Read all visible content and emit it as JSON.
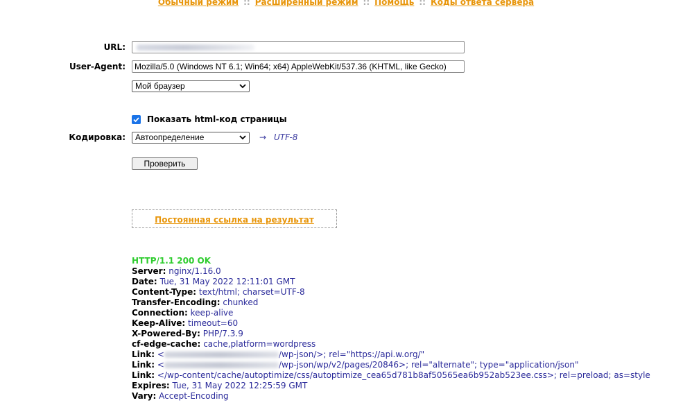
{
  "nav": {
    "items": [
      "Обычный режим",
      "Расширенный режим",
      "Помощь",
      "Коды ответа сервера"
    ],
    "separator": "::"
  },
  "form": {
    "url_label": "URL:",
    "url_value": "",
    "ua_label": "User-Agent:",
    "ua_value": "Mozilla/5.0 (Windows NT 6.1; Win64; x64) AppleWebKit/537.36 (KHTML, like Gecko)",
    "browser_select": "Мой браузер",
    "show_html_label": "Показать html-код страницы",
    "show_html_checked": true,
    "encoding_label": "Кодировка:",
    "encoding_select": "Автоопределение",
    "encoding_arrow": "→",
    "encoding_detected": "UTF-8",
    "submit_label": "Проверить"
  },
  "permalink": "Постоянная ссылка на результат",
  "response": {
    "status": "HTTP/1.1 200 OK",
    "headers": [
      {
        "name": "Server:",
        "value": "nginx/1.16.0"
      },
      {
        "name": "Date:",
        "value": "Tue, 31 May 2022 12:11:01 GMT"
      },
      {
        "name": "Content-Type:",
        "value": "text/html; charset=UTF-8"
      },
      {
        "name": "Transfer-Encoding:",
        "value": "chunked"
      },
      {
        "name": "Connection:",
        "value": "keep-alive"
      },
      {
        "name": "Keep-Alive:",
        "value": "timeout=60"
      },
      {
        "name": "X-Powered-By:",
        "value": "PHP/7.3.9"
      },
      {
        "name": "cf-edge-cache:",
        "value": "cache,platform=wordpress"
      },
      {
        "name": "Link:",
        "value_prefix": "<",
        "value": "/wp-json/>; rel=\"https://api.w.org/\""
      },
      {
        "name": "Link:",
        "value_prefix": "<",
        "value": "/wp-json/wp/v2/pages/20846>; rel=\"alternate\"; type=\"application/json\""
      },
      {
        "name": "Link:",
        "value": "</wp-content/cache/autoptimize/css/autoptimize_cea65d781b8af50565ea6b952ab523ee.css>; rel=preload; as=style"
      },
      {
        "name": "Expires:",
        "value": "Tue, 31 May 2022 12:25:59 GMT"
      },
      {
        "name": "Vary:",
        "value": "Accept-Encoding"
      }
    ]
  },
  "colors": {
    "link": "#e8960c",
    "status": "#2ecc2e",
    "header_value": "#2a2a9a",
    "checkbox": "#1a73e8"
  }
}
